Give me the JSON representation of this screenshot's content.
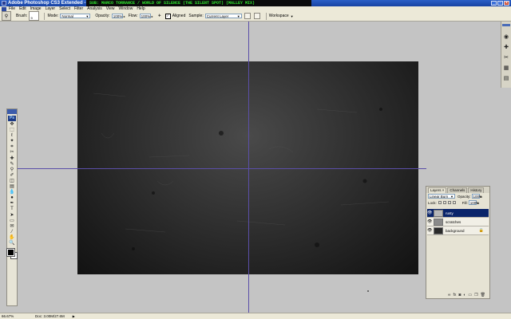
{
  "window": {
    "title": "Adobe Photoshop CS3 Extended - [u...",
    "taskbar_text": "SUB: MARCO TORRANCE / WORLD OF SILENCE (THE SILENT SPOT) (MALLEY MIX)",
    "taskbar_time": "7:53"
  },
  "menubar": {
    "items": [
      "File",
      "Edit",
      "Image",
      "Layer",
      "Select",
      "Filter",
      "Analysis",
      "View",
      "Window",
      "Help"
    ]
  },
  "options": {
    "brush_label": "Brush:",
    "brush_size": "9",
    "mode_label": "Mode:",
    "mode_value": "Normal",
    "opacity_label": "Opacity:",
    "opacity_value": "100%",
    "flow_label": "Flow:",
    "flow_value": "100%",
    "aligned_label": "Aligned",
    "sample_label": "Sample:",
    "sample_value": "Current Layer",
    "workspace_label": "Workspace"
  },
  "toolbox": {
    "badge": "Ps",
    "tools": [
      "move-tool",
      "marquee-tool",
      "lasso-tool",
      "magic-wand-tool",
      "crop-tool",
      "slice-tool",
      "healing-brush-tool",
      "brush-tool",
      "clone-stamp-tool",
      "history-brush-tool",
      "eraser-tool",
      "gradient-tool",
      "blur-tool",
      "dodge-tool",
      "pen-tool",
      "type-tool",
      "path-selection-tool",
      "shape-tool",
      "notes-tool",
      "eyedropper-tool",
      "hand-tool",
      "zoom-tool"
    ],
    "glyphs": [
      "✥",
      "⬚",
      "ℓ",
      "✦",
      "⌗",
      "✂",
      "✚",
      "✎",
      "⚲",
      "✐",
      "◫",
      "▤",
      "💧",
      "●",
      "✒",
      "T",
      "➤",
      "▭",
      "✉",
      "⁄",
      "✋",
      "🔍"
    ],
    "foreground_color": "#000000",
    "background_color": "#ffffff"
  },
  "layers_panel": {
    "tabs": [
      "Layers ×",
      "Channels",
      "History"
    ],
    "blend_mode": "Linear Burn",
    "opacity_label": "Opacity:",
    "opacity_value": "100%",
    "lock_label": "Lock:",
    "fill_label": "Fill:",
    "fill_value": "100%",
    "layers": [
      {
        "name": "rusty",
        "selected": true
      },
      {
        "name": "scratches",
        "selected": false
      },
      {
        "name": "background",
        "selected": false
      }
    ],
    "bottom_icons": [
      "link-icon",
      "fx-icon",
      "mask-icon",
      "adjustment-icon",
      "folder-icon",
      "new-layer-icon",
      "trash-icon"
    ]
  },
  "statusbar": {
    "zoom": "66.67%",
    "doc": "Doc: 3.00M/27.6M"
  },
  "colors": {
    "guide": "#5b4fa8",
    "workspace_bg": "#c4c4c4",
    "selected_layer": "#0a246a"
  }
}
